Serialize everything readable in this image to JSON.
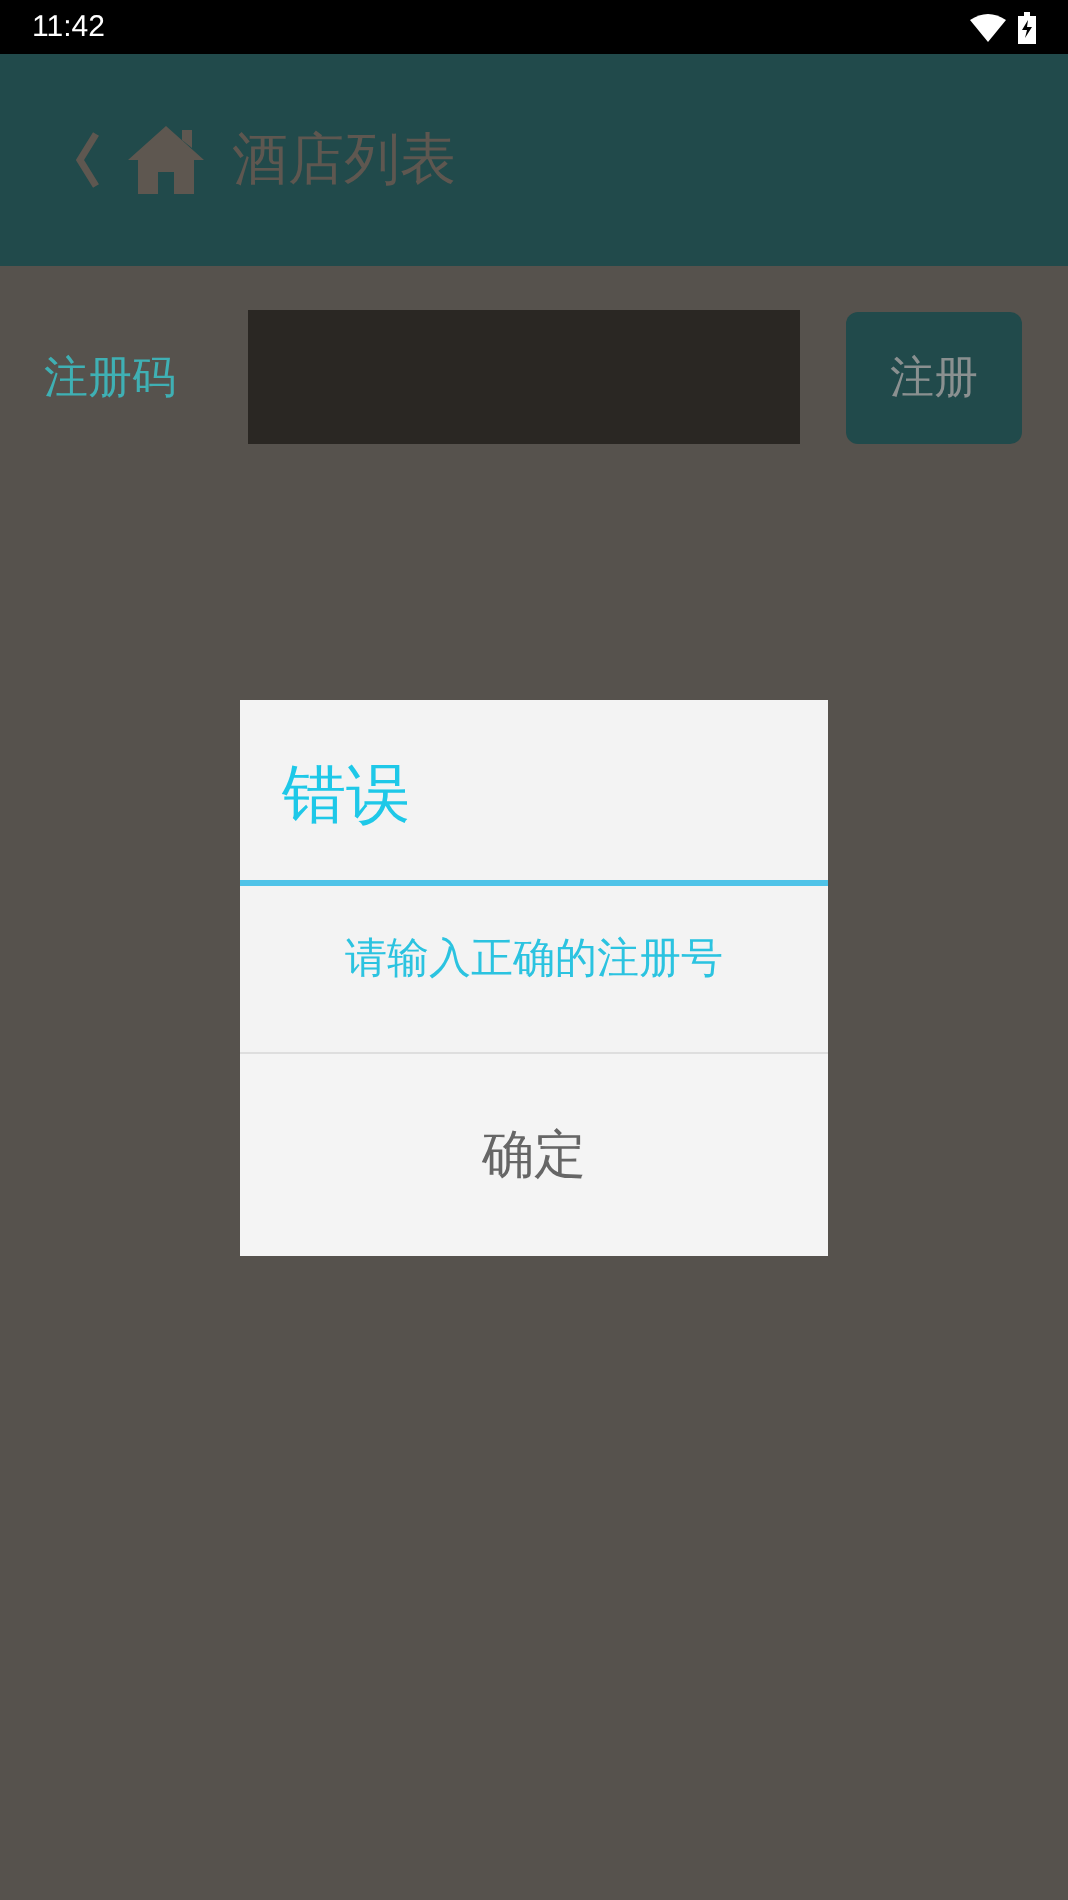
{
  "status_bar": {
    "time": "11:42"
  },
  "header": {
    "title": "酒店列表"
  },
  "form": {
    "label": "注册码",
    "button": "注册"
  },
  "dialog": {
    "title": "错误",
    "message": "请输入正确的注册号",
    "button": "确定"
  }
}
